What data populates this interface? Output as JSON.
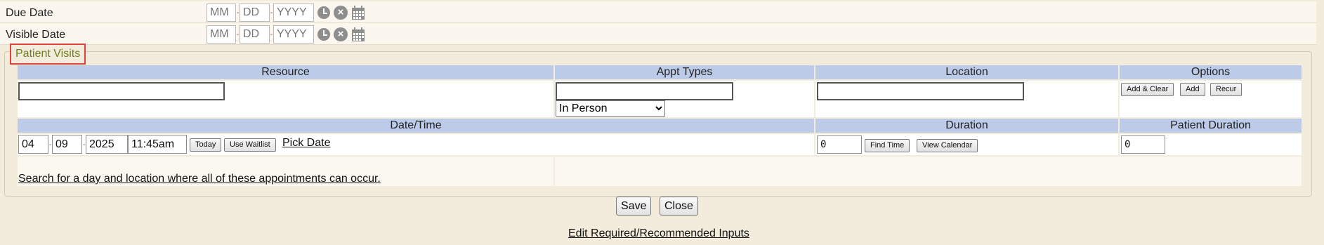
{
  "due_date": {
    "label": "Due Date",
    "mm_placeholder": "MM",
    "dd_placeholder": "DD",
    "yyyy_placeholder": "YYYY"
  },
  "visible_date": {
    "label": "Visible Date",
    "mm_placeholder": "MM",
    "dd_placeholder": "DD",
    "yyyy_placeholder": "YYYY"
  },
  "patient_visits": {
    "legend": "Patient Visits",
    "headers": {
      "resource": "Resource",
      "appt_types": "Appt Types",
      "location": "Location",
      "options": "Options",
      "date_time": "Date/Time",
      "duration": "Duration",
      "patient_duration": "Patient Duration"
    },
    "appt_mode_selected": "In Person",
    "options_buttons": {
      "add_clear": "Add & Clear",
      "add": "Add",
      "recur": "Recur"
    },
    "datetime": {
      "month": "04",
      "day": "09",
      "year": "2025",
      "time": "11:45am",
      "today_label": "Today",
      "use_waitlist_label": "Use Waitlist",
      "pick_date_label": "Pick Date"
    },
    "duration_value": "0",
    "find_time_label": "Find Time",
    "view_calendar_label": "View Calendar",
    "patient_duration_value": "0",
    "search_link": "Search for a day and location where all of these appointments can occur."
  },
  "footer": {
    "save_label": "Save",
    "close_label": "Close",
    "edit_link": "Edit Required/Recommended Inputs"
  }
}
